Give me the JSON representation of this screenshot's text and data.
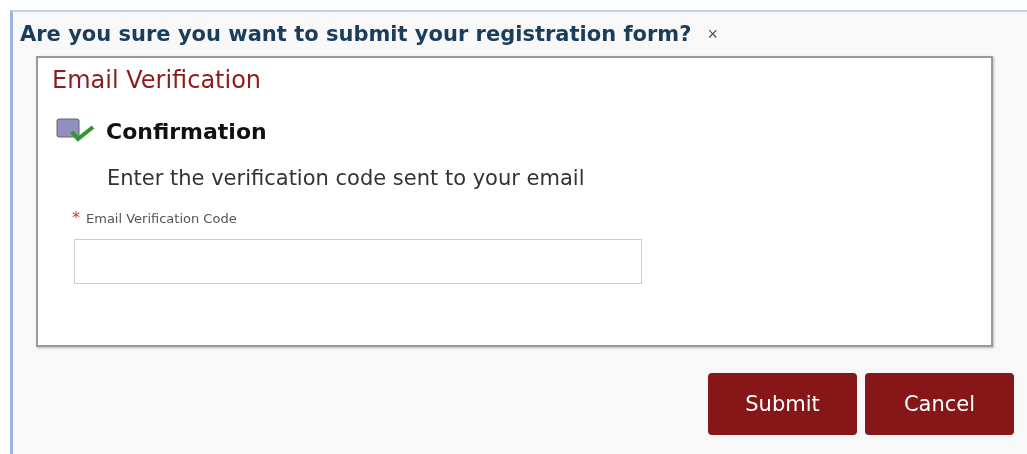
{
  "dialog": {
    "title": "Are you sure you want to submit your registration form?",
    "close": "×"
  },
  "panel": {
    "title": "Email Verification",
    "section": "Confirmation",
    "instruction": "Enter the verification code sent to your email",
    "field": {
      "required_mark": "*",
      "label": "Email Verification Code"
    }
  },
  "buttons": [
    "Submit",
    "Cancel"
  ]
}
